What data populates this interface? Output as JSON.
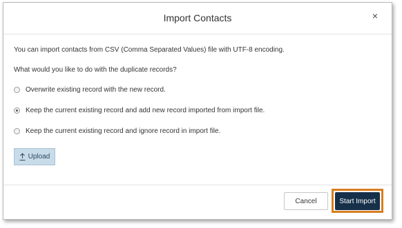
{
  "dialog": {
    "title": "Import Contacts",
    "close_icon": "×",
    "intro_text": "You can import contacts from CSV (Comma Separated Values) file with UTF-8 encoding.",
    "question_text": "What would you like to do with the duplicate records?",
    "options": [
      {
        "label": "Overwrite existing record with the new record.",
        "checked": false
      },
      {
        "label": "Keep the current existing record and add new record imported from import file.",
        "checked": true
      },
      {
        "label": "Keep the current existing record and ignore record in import file.",
        "checked": false
      }
    ],
    "upload_label": "Upload",
    "cancel_label": "Cancel",
    "start_label": "Start Import"
  },
  "colors": {
    "primary_button": "#16304a",
    "highlight_outline": "#d87d1f",
    "upload_button": "#c7dbe8"
  },
  "icons": {
    "upload": "upload-arrow-icon",
    "close": "close-icon"
  }
}
